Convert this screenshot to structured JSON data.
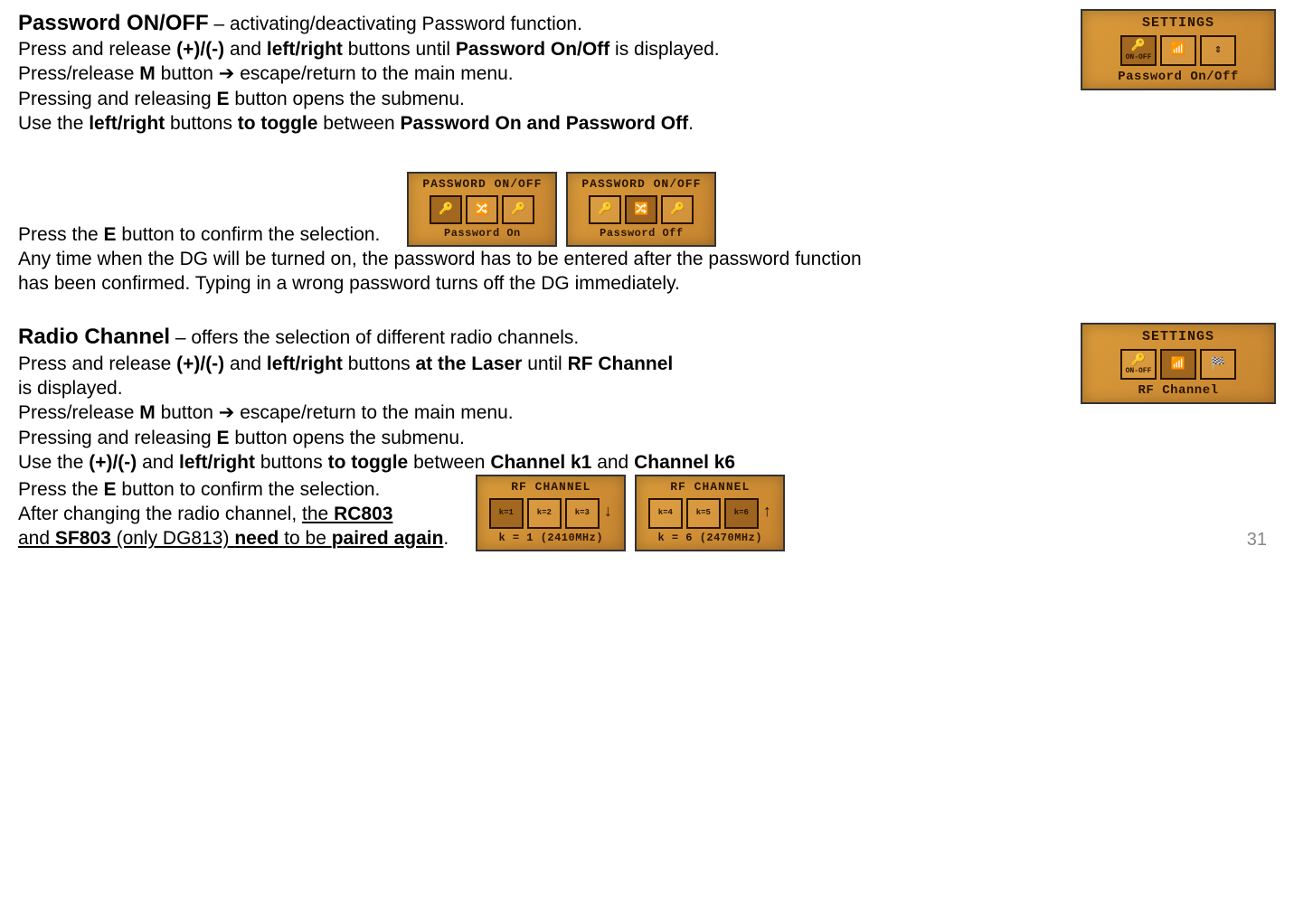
{
  "sec1": {
    "heading": "Password ON/OFF",
    "heading_tail": " – activating/deactivating Password function.",
    "l2a": "Press and release ",
    "l2b": "(+)/(-)",
    "l2c": " and ",
    "l2d": "left/right",
    "l2e": " buttons until ",
    "l2f": "Password On/Off",
    "l2g": " is displayed.",
    "l3a": "Press/release ",
    "l3b": "M",
    "l3c": " button ",
    "l3d": "➔",
    "l3e": " escape/return to the main menu.",
    "l4a": "Pressing and releasing ",
    "l4b": "E",
    "l4c": " button opens the submenu.",
    "l5a": "Use the ",
    "l5b": "left/right",
    "l5c": " buttons ",
    "l5d": "to toggle",
    "l5e": " between ",
    "l5f": "Password On and Password Off",
    "l5g": ".",
    "l6a": "Press the ",
    "l6b": "E",
    "l6c": " button to confirm the selection.",
    "l7": "Any time when the DG will be turned on, the password has to be entered after the password function has been confirmed. Typing in a wrong password turns off the DG immediately."
  },
  "lcd_settings1": {
    "title": "SETTINGS",
    "caption": "Password On/Off",
    "i1": "🔑",
    "i1b": "ON-OFF",
    "i2": "📶",
    "i3": "⇕"
  },
  "lcd_pw_on": {
    "title": "PASSWORD ON/OFF",
    "caption": "Password On",
    "i1": "🔑",
    "i2": "🔀",
    "i3": "🔑"
  },
  "lcd_pw_off": {
    "title": "PASSWORD ON/OFF",
    "caption": "Password Off",
    "i1": "🔑",
    "i2": "🔀",
    "i3": "🔑"
  },
  "sec2": {
    "heading": "Radio Channel",
    "heading_tail": " – offers the selection of different radio channels.",
    "l2a": "Press and release ",
    "l2b": "(+)/(-)",
    "l2c": " and ",
    "l2d": "left/right",
    "l2e": " buttons ",
    "l2f": "at the Laser",
    "l2g": " until ",
    "l2h": "RF Channel",
    "l2i": " is displayed.",
    "l3a": "Press/release ",
    "l3b": "M",
    "l3c": " button ",
    "l3d": "➔",
    "l3e": " escape/return to the main menu.",
    "l4a": "Pressing and releasing ",
    "l4b": "E",
    "l4c": " button opens the submenu.",
    "l5a": "Use the ",
    "l5b": "(+)/(-)",
    "l5c": " and ",
    "l5d": "left/right",
    "l5e": "  buttons ",
    "l5f": "to toggle",
    "l5g": " between ",
    "l5h": "Channel k1",
    "l5i": " and ",
    "l5j": "Channel k6",
    "l6a": "Press the ",
    "l6b": "E",
    "l6c": " button to confirm the selection.",
    "l7a": "After changing the radio channel, ",
    "l7b": "the ",
    "l7c": "RC803",
    "l8a": "and ",
    "l8b": "SF803",
    "l8c": " (only DG813) ",
    "l8d": "need",
    "l8e": " to be ",
    "l8f": "paired again",
    "l8g": "."
  },
  "lcd_settings2": {
    "title": "SETTINGS",
    "caption": "RF Channel",
    "i1": "🔑",
    "i1b": "ON-OFF",
    "i2": "📶",
    "i3": "🏁"
  },
  "lcd_rf1": {
    "title": "RF CHANNEL",
    "caption": "k = 1 (2410MHz)",
    "k1": "k=1",
    "k2": "k=2",
    "k3": "k=3",
    "arrow": "↓"
  },
  "lcd_rf2": {
    "title": "RF CHANNEL",
    "caption": "k = 6 (2470MHz)",
    "k4": "k=4",
    "k5": "k=5",
    "k6": "k=6",
    "arrow": "↑"
  },
  "page": "31"
}
